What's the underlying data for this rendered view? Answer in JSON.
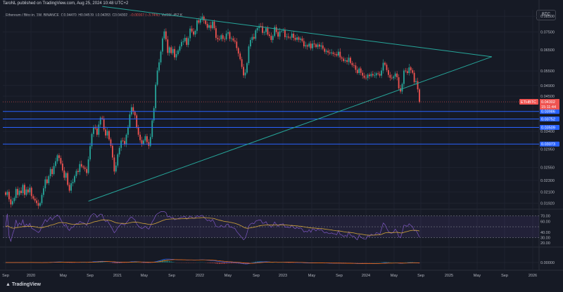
{
  "header": {
    "publisher_line": "TaroNL published on TradingView.com, Aug 25, 2024 10:48 UTC+2"
  },
  "instrument": {
    "name": "Ethereum / Bitcoin, 1W, BINANCE",
    "open_label": "O",
    "open": "0.04470",
    "high_label": "H",
    "high": "0.04509",
    "low_label": "L",
    "low": "0.04283",
    "close_label": "C",
    "close": "0.04302",
    "change": "−0.00167 (−3.74%)",
    "volume_label": "Vol",
    "volume": "156.452 K"
  },
  "currency_button": "BTC",
  "branding": "TradingView",
  "colors": {
    "up": "#26a69a",
    "down": "#ef5350",
    "trend": "#26a69a",
    "level": "#2962ff",
    "rsi": "#7e57c2",
    "rsi_ma": "#d4a73a",
    "macd": "#2962ff",
    "signal": "#ff6d00"
  },
  "chart_data": [
    {
      "type": "candlestick",
      "title": "",
      "x_ticks": [
        "Sep",
        "2020",
        "May",
        "Sep",
        "2021",
        "May",
        "Sep",
        "2022",
        "May",
        "Sep",
        "2023",
        "May",
        "Sep",
        "2024",
        "May",
        "Sep",
        "2025",
        "May",
        "Sep",
        "2026"
      ],
      "y_ticks": [
        "0.08500",
        "0.07500",
        "0.06500",
        "0.05500",
        "0.04900",
        "0.04500",
        "0.03400",
        "0.02950",
        "0.02550",
        "0.02300",
        "0.02100",
        "0.01920"
      ],
      "ylim": [
        0.0185,
        0.0895
      ],
      "scale": "log",
      "current_price": {
        "symbol": "ETHBTC",
        "value": "0.04302",
        "countdown": "15:11:44"
      },
      "horizontal_levels": [
        "0.03986",
        "0.03752",
        "0.03509",
        "0.03073"
      ],
      "weekly_closes": [
        0.0205,
        0.021,
        0.0198,
        0.019,
        0.0195,
        0.02,
        0.0215,
        0.0205,
        0.0212,
        0.0208,
        0.0222,
        0.0205,
        0.0214,
        0.0209,
        0.0217,
        0.0203,
        0.0199,
        0.0196,
        0.0192,
        0.0188,
        0.0192,
        0.0205,
        0.0216,
        0.0232,
        0.0225,
        0.0238,
        0.0252,
        0.0242,
        0.0258,
        0.0268,
        0.0281,
        0.0275,
        0.0263,
        0.0249,
        0.0235,
        0.0244,
        0.0222,
        0.0212,
        0.0225,
        0.0227,
        0.0238,
        0.0248,
        0.0246,
        0.0262,
        0.0257,
        0.0255,
        0.0252,
        0.0244,
        0.0272,
        0.0302,
        0.0333,
        0.0352,
        0.0348,
        0.0331,
        0.0359,
        0.0379,
        0.0377,
        0.0345,
        0.0329,
        0.0341,
        0.0319,
        0.0303,
        0.0276,
        0.0247,
        0.0259,
        0.0283,
        0.0298,
        0.0316,
        0.0315,
        0.0306,
        0.0331,
        0.0352,
        0.0389,
        0.0412,
        0.0397,
        0.0386,
        0.0351,
        0.0331,
        0.0317,
        0.0308,
        0.0316,
        0.0327,
        0.0312,
        0.0303,
        0.0325,
        0.0371,
        0.0409,
        0.0493,
        0.0552,
        0.0589,
        0.0642,
        0.0713,
        0.0754,
        0.0707,
        0.0635,
        0.0664,
        0.0634,
        0.0655,
        0.0613,
        0.0629,
        0.0647,
        0.0669,
        0.0693,
        0.0697,
        0.0716,
        0.0677,
        0.0714,
        0.0771,
        0.0753,
        0.0735,
        0.0757,
        0.0823,
        0.0808,
        0.0831,
        0.0848,
        0.0822,
        0.08,
        0.0776,
        0.0792,
        0.0773,
        0.0815,
        0.0773,
        0.0716,
        0.0709,
        0.0708,
        0.0731,
        0.071,
        0.0708,
        0.0741,
        0.0749,
        0.071,
        0.0713,
        0.0701,
        0.0695,
        0.066,
        0.0632,
        0.0604,
        0.0568,
        0.0531,
        0.0543,
        0.0585,
        0.0669,
        0.0704,
        0.0721,
        0.0711,
        0.076,
        0.0774,
        0.0787,
        0.0786,
        0.0745,
        0.075,
        0.0773,
        0.0735,
        0.0727,
        0.0704,
        0.0727,
        0.078,
        0.075,
        0.0723,
        0.0754,
        0.0757,
        0.0762,
        0.072,
        0.0723,
        0.0718,
        0.0717,
        0.074,
        0.0716,
        0.0705,
        0.0719,
        0.0705,
        0.0712,
        0.0698,
        0.0669,
        0.0675,
        0.0668,
        0.0684,
        0.0659,
        0.0684,
        0.068,
        0.0665,
        0.0679,
        0.0668,
        0.0674,
        0.0657,
        0.0641,
        0.0646,
        0.0637,
        0.0633,
        0.0637,
        0.063,
        0.0629,
        0.0622,
        0.0641,
        0.0613,
        0.0607,
        0.0595,
        0.0599,
        0.0591,
        0.0611,
        0.0586,
        0.0576,
        0.0575,
        0.0555,
        0.0541,
        0.0561,
        0.0542,
        0.053,
        0.0521,
        0.052,
        0.0534,
        0.0528,
        0.0537,
        0.0531,
        0.0531,
        0.054,
        0.0537,
        0.053,
        0.0552,
        0.0587,
        0.0578,
        0.0554,
        0.0533,
        0.0521,
        0.0519,
        0.0526,
        0.0539,
        0.0523,
        0.0479,
        0.0467,
        0.0496,
        0.0552,
        0.0549,
        0.0541,
        0.0566,
        0.0553,
        0.0542,
        0.0503,
        0.0507,
        0.0475,
        0.043
      ]
    },
    {
      "type": "line",
      "title": "",
      "y_ticks": [
        "70.00",
        "60.00",
        "40.00",
        "30.00",
        "20.00"
      ],
      "ylim": [
        15,
        80
      ],
      "overbought": 70,
      "oversold": 30
    },
    {
      "type": "area",
      "title": "",
      "y_ticks": [
        "0.00000"
      ]
    }
  ]
}
